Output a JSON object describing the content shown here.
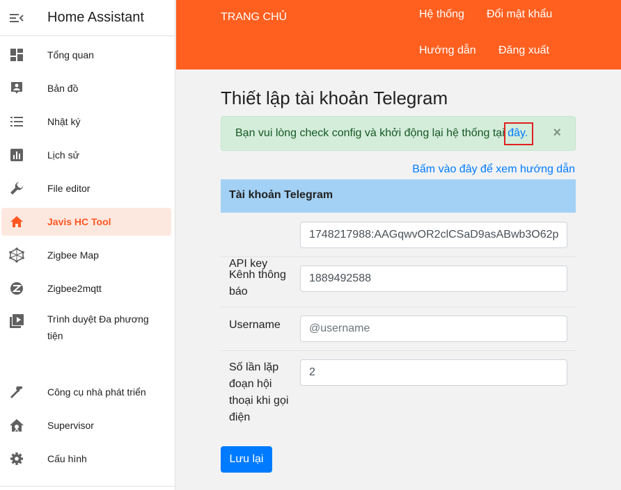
{
  "sidebar": {
    "title": "Home Assistant",
    "items": [
      {
        "label": "Tổng quan",
        "icon": "dashboard-icon"
      },
      {
        "label": "Bản đồ",
        "icon": "map-icon"
      },
      {
        "label": "Nhật ký",
        "icon": "logbook-icon"
      },
      {
        "label": "Lịch sử",
        "icon": "history-icon"
      },
      {
        "label": "File editor",
        "icon": "wrench-icon"
      },
      {
        "label": "Javis HC Tool",
        "icon": "home-icon",
        "active": true
      },
      {
        "label": "Zigbee Map",
        "icon": "network-icon"
      },
      {
        "label": "Zigbee2mqtt",
        "icon": "zigbee-icon"
      },
      {
        "label": "Trình duyệt Đa phương tiện",
        "icon": "media-icon"
      },
      {
        "label": "Công cụ nhà phát triển",
        "icon": "hammer-icon"
      },
      {
        "label": "Supervisor",
        "icon": "supervisor-icon"
      },
      {
        "label": "Cấu hình",
        "icon": "gear-icon"
      }
    ]
  },
  "topbar": {
    "brand": "Trang chủ",
    "nav": [
      "Hệ thống",
      "Đổi mật khẩu",
      "Hướng dẫn",
      "Đăng xuất"
    ]
  },
  "main": {
    "title": "Thiết lập tài khoản Telegram",
    "alert": {
      "text": "Bạn vui lòng check config và khởi động lại hệ thống tại ",
      "link": "đây.",
      "close": "×"
    },
    "guide_link": "Bấm vào đây để xem hướng dẫn",
    "card_title": "Tài khoản Telegram",
    "fields": [
      {
        "label": "API key",
        "value": "1748217988:AAGqwvOR2clCSaD9asABwb3O62p",
        "placeholder": ""
      },
      {
        "label": "Kênh thông báo",
        "value": "1889492588",
        "placeholder": ""
      },
      {
        "label": "Username",
        "value": "",
        "placeholder": "@username"
      },
      {
        "label": "Số lần lặp đoạn hội thoại khi gọi điện",
        "value": "2",
        "placeholder": ""
      }
    ],
    "save_label": "Lưu lại"
  },
  "colors": {
    "accent": "#ff5f1f",
    "active_bg": "#fde8df",
    "alert_bg": "#d4edda",
    "card_head": "#a3d1f5",
    "primary": "#007bff"
  }
}
